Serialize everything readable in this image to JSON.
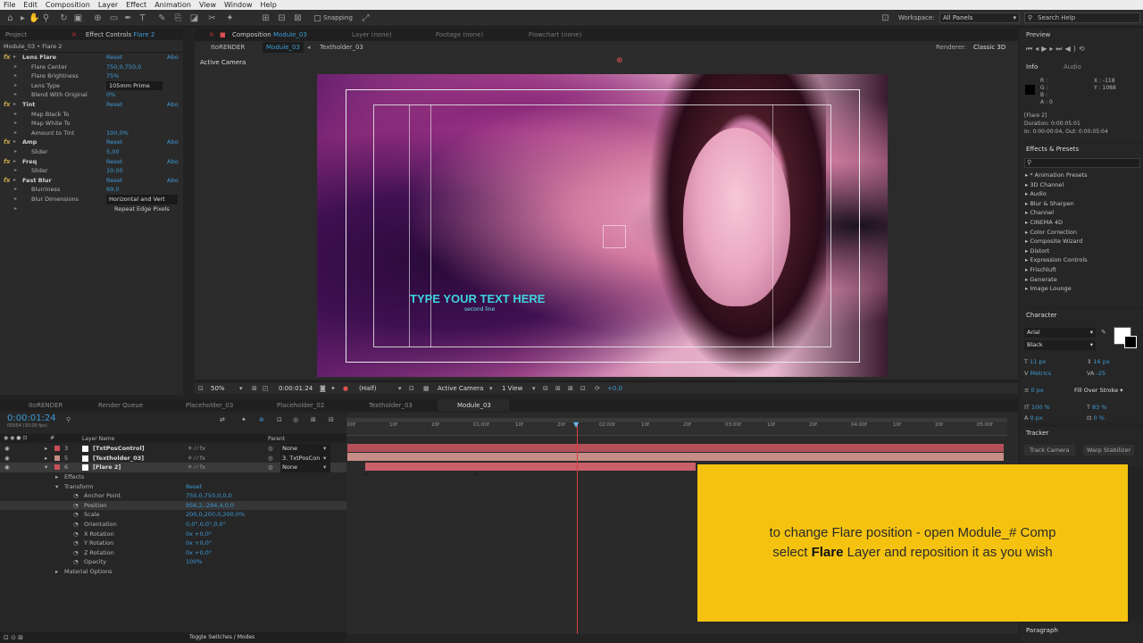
{
  "menu": [
    "File",
    "Edit",
    "Composition",
    "Layer",
    "Effect",
    "Animation",
    "View",
    "Window",
    "Help"
  ],
  "toolbar": {
    "snapping": "Snapping",
    "workspace_label": "Workspace:",
    "workspace_value": "All Panels",
    "search_placeholder": "Search Help"
  },
  "left_panel": {
    "tab_project": "Project",
    "tab_effect_controls": "Effect Controls",
    "tab_effect_target": "Flare 2",
    "breadcrumb": "Module_03 • Flare 2",
    "rows": [
      {
        "name": "Lens Flare",
        "value": "Reset",
        "extra": "Abo",
        "fx": true
      },
      {
        "name": "Flare Center",
        "value": "750,0,750,0"
      },
      {
        "name": "Flare Brightness",
        "value": "75%"
      },
      {
        "name": "Lens Type",
        "value": "105mm Prime"
      },
      {
        "name": "Blend With Original",
        "value": "0%"
      },
      {
        "name": "Tint",
        "value": "Reset",
        "extra": "Abo",
        "fx": true
      },
      {
        "name": "Map Black To",
        "value": ""
      },
      {
        "name": "Map White To",
        "value": ""
      },
      {
        "name": "Amount to Tint",
        "value": "100,0%"
      },
      {
        "name": "Amp",
        "value": "Reset",
        "extra": "Abo",
        "fx": true
      },
      {
        "name": "Slider",
        "value": "5,00"
      },
      {
        "name": "Freq",
        "value": "Reset",
        "extra": "Abo",
        "fx": true
      },
      {
        "name": "Slider",
        "value": "10,00"
      },
      {
        "name": "Fast Blur",
        "value": "Reset",
        "extra": "Abo",
        "fx": true
      },
      {
        "name": "Blurriness",
        "value": "69,0"
      },
      {
        "name": "Blur Dimensions",
        "value": "Horizontal and Vert"
      },
      {
        "name": "",
        "value": "Repeat Edge Pixels"
      }
    ]
  },
  "comp_panel": {
    "tabs": [
      "Composition Module_03",
      "Layer (none)",
      "Footage (none)",
      "Flowchart (none)"
    ],
    "sub_tabs": [
      "ItoRENDER",
      "Module_03",
      "Textholder_03"
    ],
    "renderer_label": "Renderer:",
    "renderer_value": "Classic 3D",
    "active_camera": "Active Camera",
    "headline": "TYPE YOUR TEXT HERE",
    "subline": "second line",
    "bottom_bar": {
      "zoom": "50%",
      "timecode": "0:00:01:24",
      "resolution": "(Half)",
      "view": "Active Camera",
      "views": "1 View",
      "exposure": "+0,0"
    }
  },
  "timeline": {
    "tabs": [
      "ItoRENDER",
      "Render Queue",
      "Placeholder_03",
      "Placeholder_02",
      "Textholder_03",
      "Module_03"
    ],
    "timecode": "0:00:01:24",
    "fps": "00054 (30.00 fps)",
    "col_layer": "Layer Name",
    "col_parent": "Parent",
    "layers": [
      {
        "num": "3",
        "name": "[TxtPosControl]",
        "parent": "None"
      },
      {
        "num": "5",
        "name": "[Textholder_03]",
        "parent": "3. TxtPosCon"
      },
      {
        "num": "6",
        "name": "[Flare 2]",
        "parent": "None"
      }
    ],
    "props": [
      {
        "name": "Effects",
        "value": ""
      },
      {
        "name": "Transform",
        "value": "Reset"
      },
      {
        "name": "Anchor Point",
        "value": "750,0,750,0,0,0"
      },
      {
        "name": "Position",
        "value": "956,2,-294,4,0,0"
      },
      {
        "name": "Scale",
        "value": "200,0,200,0,200,0%"
      },
      {
        "name": "Orientation",
        "value": "0,0°,0,0°,0,0°"
      },
      {
        "name": "X Rotation",
        "value": "0x +0,0°"
      },
      {
        "name": "Y Rotation",
        "value": "0x +0,0°"
      },
      {
        "name": "Z Rotation",
        "value": "0x +0,0°"
      },
      {
        "name": "Opacity",
        "value": "100%"
      },
      {
        "name": "Material Options",
        "value": ""
      }
    ],
    "ruler": [
      "00f",
      "10f",
      "20f",
      "01:00f",
      "10f",
      "20f",
      "02:00f",
      "10f",
      "20f",
      "03:00f",
      "10f",
      "20f",
      "04:00f",
      "10f",
      "20f",
      "05:00f"
    ],
    "toggle_label": "Toggle Switches / Modes"
  },
  "right_panel": {
    "preview": "Preview",
    "info_tab": "Info",
    "audio_tab": "Audio",
    "info_rgb": [
      "R :",
      "G :",
      "B :",
      "A : 0"
    ],
    "info_xy": [
      "X : -118",
      "Y : 1088"
    ],
    "info_layer": "[Flare 2]",
    "info_duration": "Duration: 0:00:05:01",
    "info_inout": "In: 0:00:00:04, Out: 0:00:05:04",
    "effects_presets": "Effects & Presets",
    "effects_list": [
      "* Animation Presets",
      "3D Channel",
      "Audio",
      "Blur & Sharpen",
      "Channel",
      "CINEMA 4D",
      "Color Correction",
      "Composite Wizard",
      "Distort",
      "Expression Controls",
      "Frischluft",
      "Generate",
      "Image Lounge"
    ],
    "character": "Character",
    "font": "Arial",
    "font_style": "Black",
    "font_size": "11 px",
    "leading": "16 px",
    "kerning": "Metrics",
    "tracking": "-25",
    "stroke": "0 px",
    "stroke_type": "Fill Over Stroke",
    "v_scale": "100 %",
    "h_scale": "83 %",
    "baseline": "0 px",
    "tsume": "0 %",
    "tracker": "Tracker",
    "track_camera": "Track Camera",
    "warp_stabilizer": "Warp Stabilizer",
    "paragraph": "Paragraph"
  },
  "overlay": {
    "line1": "to change Flare position - open Module_# Comp",
    "line2_pre": "select ",
    "line2_bold": "Flare",
    "line2_post": " Layer and reposition it as you wish"
  },
  "colors": {
    "accent": "#3e9ad6",
    "overlay": "#f5c30f",
    "track_red": "#b4505a",
    "playhead": "#d24040"
  }
}
